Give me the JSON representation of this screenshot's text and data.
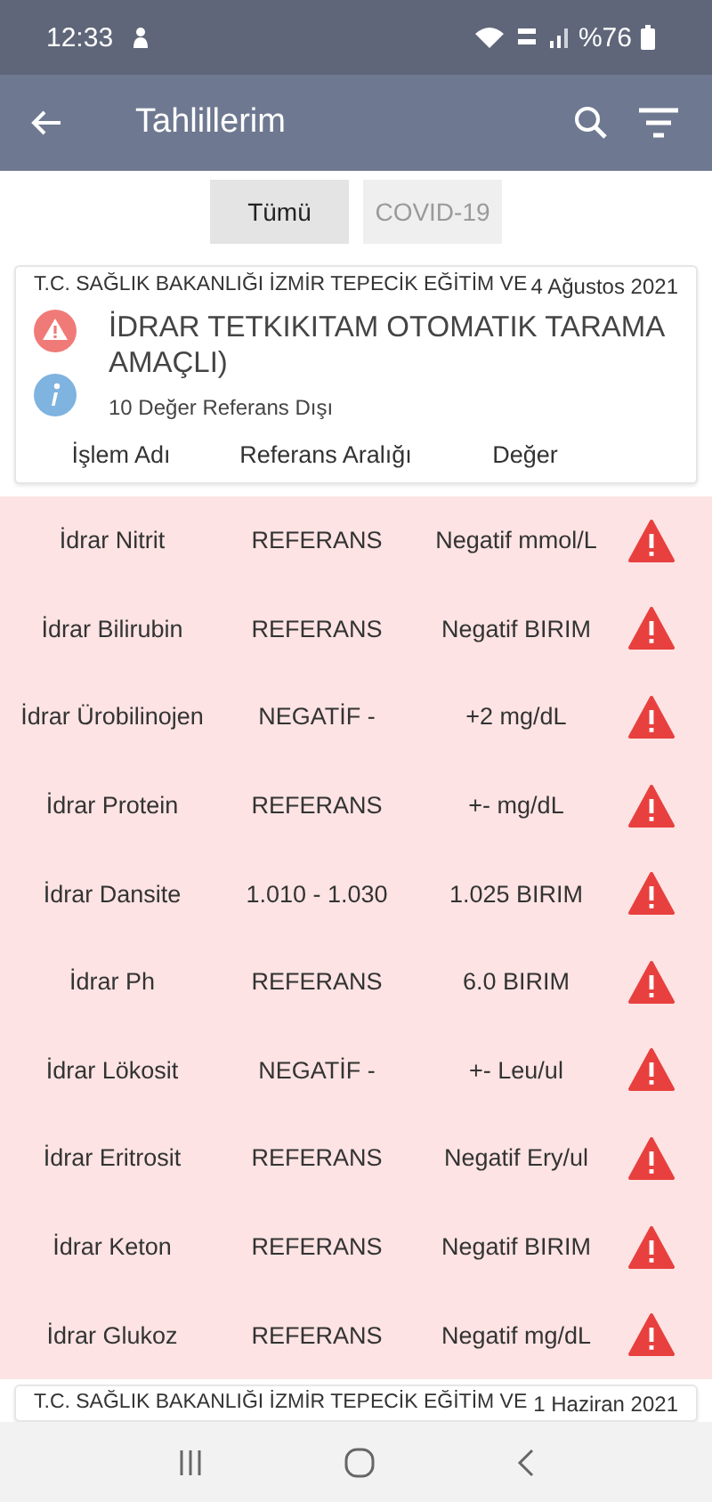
{
  "status_bar": {
    "time": "12:33",
    "battery": "%76"
  },
  "app_bar": {
    "title": "Tahlillerim"
  },
  "filters": [
    {
      "label": "Tümü",
      "selected": true
    },
    {
      "label": "COVID-19",
      "selected": false
    }
  ],
  "report": {
    "institution": "T.C. SAĞLIK BAKANLIĞI  İZMİR TEPECİK EĞİTİM VE",
    "date": "4 Ağustos 2021",
    "title": "İDRAR TETKIKITAM OTOMATIK TARAMA AMAÇLI)",
    "summary": "10 Değer Referans Dışı",
    "columns": [
      "İşlem Adı",
      "Referans Aralığı",
      "Değer"
    ],
    "rows": [
      {
        "name": "İdrar Nitrit",
        "reference": "REFERANS",
        "value": "Negatif mmol/L",
        "out_of_range": true
      },
      {
        "name": "İdrar Bilirubin",
        "reference": "REFERANS",
        "value": "Negatif BIRIM",
        "out_of_range": true
      },
      {
        "name": "İdrar Ürobilinojen",
        "reference": "NEGATİF -",
        "value": "+2 mg/dL",
        "out_of_range": true
      },
      {
        "name": "İdrar Protein",
        "reference": "REFERANS",
        "value": "+- mg/dL",
        "out_of_range": true
      },
      {
        "name": "İdrar Dansite",
        "reference": "1.010 - 1.030",
        "value": "1.025 BIRIM",
        "out_of_range": true
      },
      {
        "name": "İdrar Ph",
        "reference": "REFERANS",
        "value": "6.0 BIRIM",
        "out_of_range": true
      },
      {
        "name": "İdrar Lökosit",
        "reference": "NEGATİF -",
        "value": "+- Leu/ul",
        "out_of_range": true
      },
      {
        "name": "İdrar Eritrosit",
        "reference": "REFERANS",
        "value": "Negatif Ery/ul",
        "out_of_range": true
      },
      {
        "name": "İdrar Keton",
        "reference": "REFERANS",
        "value": "Negatif BIRIM",
        "out_of_range": true
      },
      {
        "name": "İdrar Glukoz",
        "reference": "REFERANS",
        "value": "Negatif mg/dL",
        "out_of_range": true
      }
    ]
  },
  "next_report": {
    "institution": "T.C. SAĞLIK BAKANLIĞI  İZMİR TEPECİK EĞİTİM VE",
    "date": "1 Haziran 2021"
  }
}
